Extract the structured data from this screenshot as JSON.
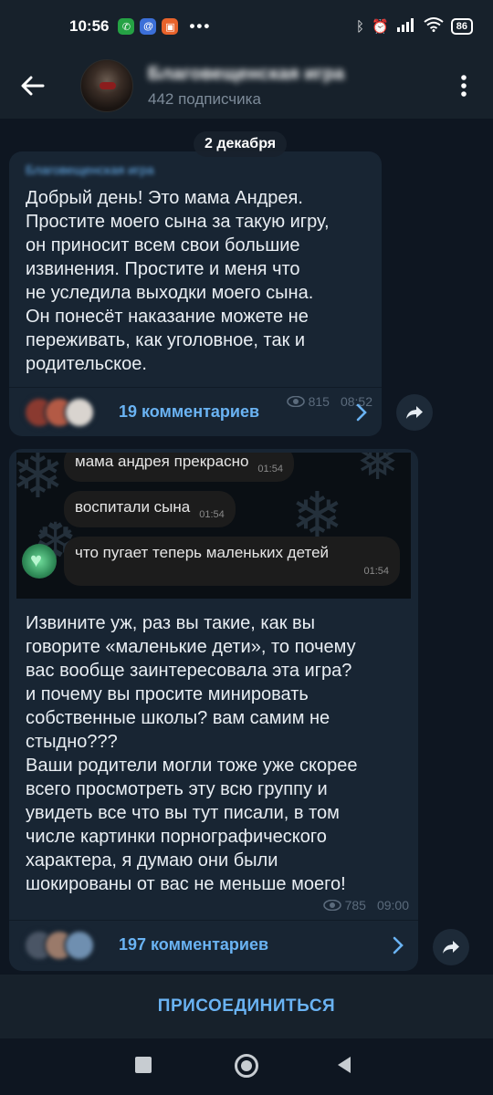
{
  "status_bar": {
    "time": "10:56",
    "app_icons": [
      "whatsapp-icon",
      "email-icon",
      "app-icon"
    ],
    "overflow": "•••",
    "right_icons": [
      "bluetooth-icon",
      "alarm-icon",
      "signal-icon",
      "wifi-icon"
    ],
    "battery": "86"
  },
  "header": {
    "back_icon": "arrow-left-icon",
    "channel_title": "Благовещенская игра",
    "subscribers": "442 подписчика",
    "menu_icon": "vertical-dots-icon"
  },
  "chat": {
    "date": "2 декабря",
    "posts": [
      {
        "author": "Благовещенская игра",
        "text": "Добрый день! Это мама Андрея.\nПростите моего сына за такую игру,\nон приносит всем свои большие\nизвинения. Простите и меня что\nне уследила выходки моего сына.\nОн понесёт наказание можете не\nпереживать, как уголовное, так и\nродительское.",
        "views": "815",
        "time": "08:52",
        "comments": "19 комментариев"
      },
      {
        "embedded_messages": [
          {
            "text": "мама андрея прекрасно",
            "time": "01:54"
          },
          {
            "text": "воспитали сына",
            "time": "01:54"
          },
          {
            "text": "что пугает теперь маленьких детей",
            "time": "01:54"
          }
        ],
        "text": "Извините уж, раз вы такие, как вы\nговорите «маленькие дети», то почему\nвас вообще заинтересовала эта игра?\nи почему вы просите минировать\nсобственные школы? вам самим не\nстыдно???\nВаши родители могли тоже уже скорее\nвсего просмотреть эту всю группу и\nувидеть все что вы тут писали, в том\nчисле картинки  порнографического\nхарактера, я думаю они были\nшокированы от вас не меньше моего!",
        "views": "785",
        "time": "09:00",
        "comments": "197 комментариев"
      }
    ]
  },
  "join_button": "ПРИСОЕДИНИТЬСЯ",
  "colors": {
    "background": "#0e1621",
    "bubble": "#182533",
    "header": "#17212b",
    "accent": "#6ab3f3",
    "meta": "#5b6b7c"
  }
}
